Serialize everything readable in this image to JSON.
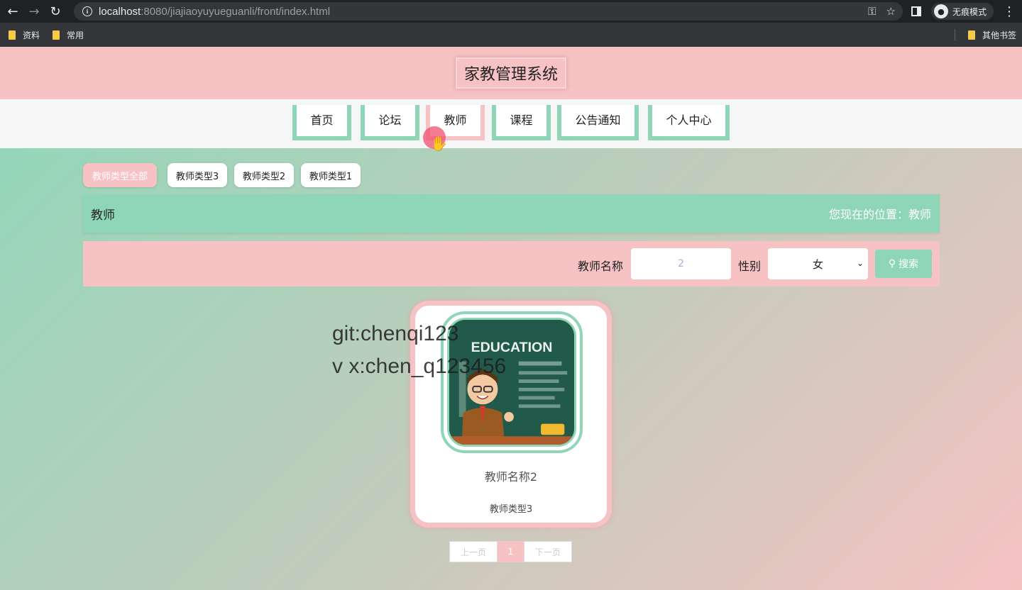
{
  "browser": {
    "url_host": "localhost",
    "url_path": ":8080/jiajiaoyuyueguanli/front/index.html",
    "incognito_label": "无痕模式",
    "bookmarks": [
      "资料",
      "常用"
    ],
    "bookmark_other": "其他书签"
  },
  "header": {
    "title": "家教管理系统"
  },
  "nav": {
    "items": [
      "首页",
      "论坛",
      "教师",
      "课程",
      "公告通知",
      "个人中心"
    ],
    "active": "教师"
  },
  "categories": {
    "items": [
      "教师类型全部",
      "教师类型3",
      "教师类型2",
      "教师类型1"
    ],
    "active": "教师类型全部"
  },
  "breadcrumb": {
    "title": "教师",
    "location": "您现在的位置：教师"
  },
  "search": {
    "name_label": "教师名称",
    "name_value": "2",
    "gender_label": "性别",
    "gender_value": "女",
    "button_label": "搜索"
  },
  "cards": [
    {
      "name": "教师名称2",
      "type": "教师类型3"
    }
  ],
  "card_image_text": "EDUCATION",
  "pagination": {
    "prev": "上一页",
    "current": "1",
    "next": "下一页"
  },
  "watermark": {
    "line1": "git:chenqi123",
    "line2": "v x:chen_q123456"
  },
  "colors": {
    "pink": "#f6c2c4",
    "mint": "#8ed6b7"
  }
}
